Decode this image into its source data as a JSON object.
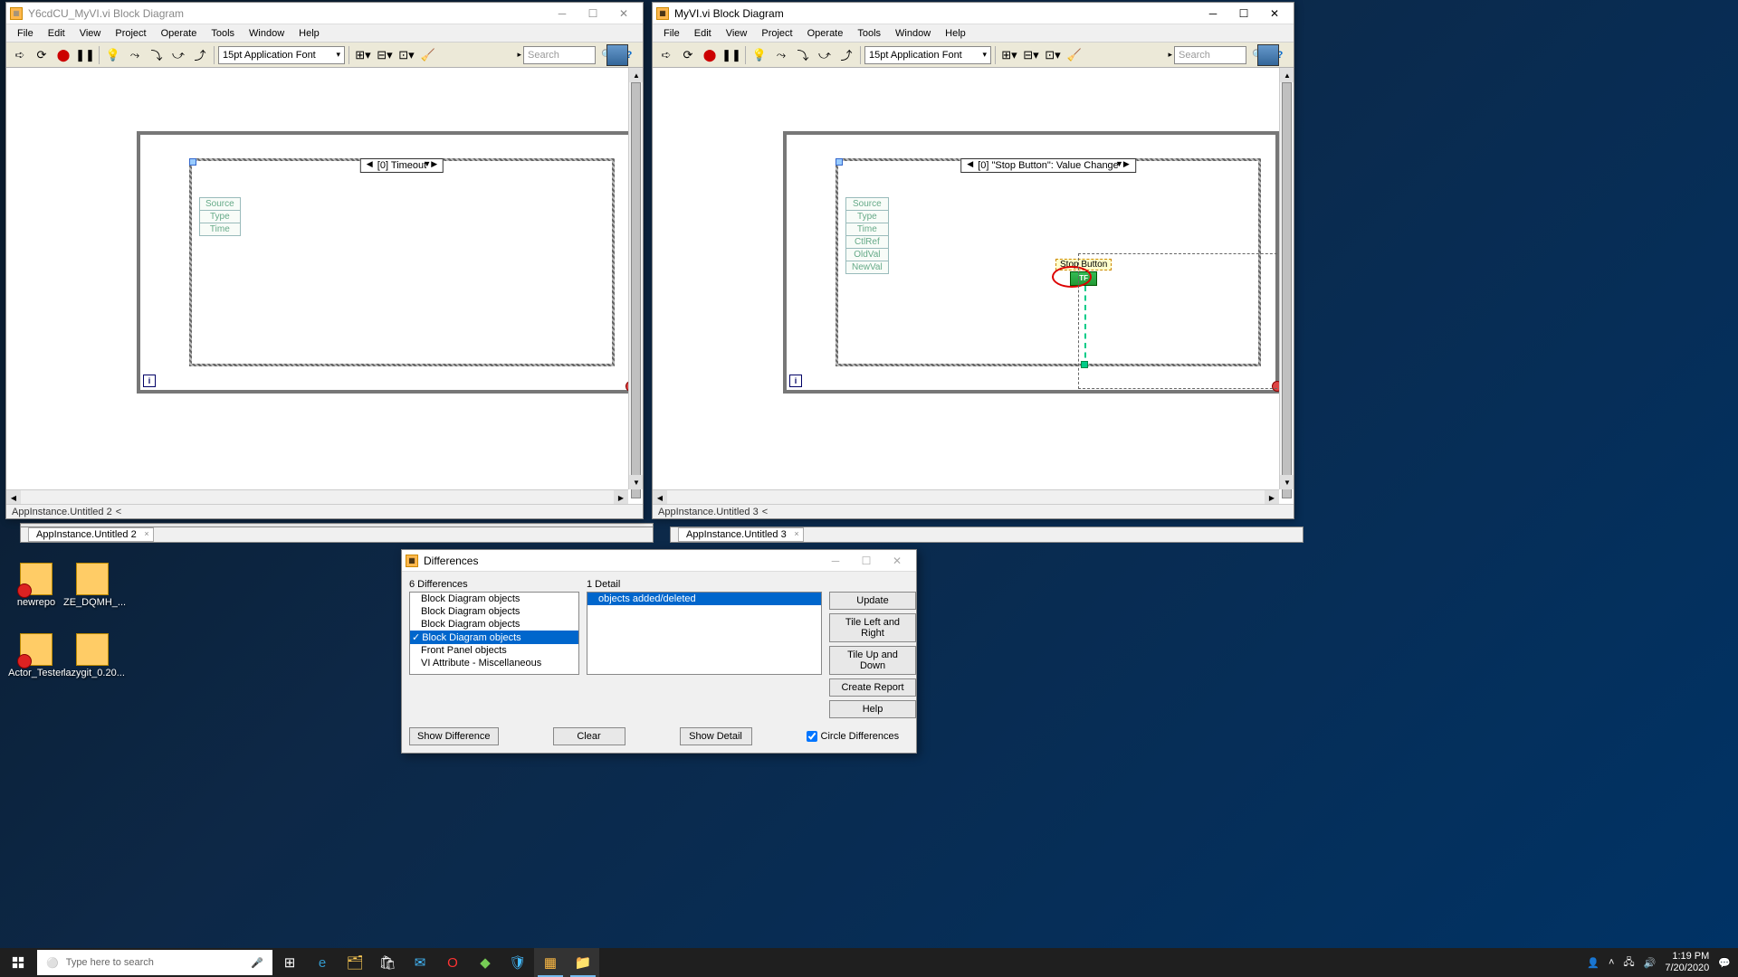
{
  "left_window": {
    "title": "Y6cdCU_MyVI.vi Block Diagram",
    "menus": [
      "File",
      "Edit",
      "View",
      "Project",
      "Operate",
      "Tools",
      "Window",
      "Help"
    ],
    "font_selector": "15pt Application Font",
    "search_placeholder": "Search",
    "event_case_label": "[0] Timeout",
    "event_fields": [
      "Source",
      "Type",
      "Time"
    ],
    "status_text": "AppInstance.Untitled  2",
    "tab_text": "AppInstance.Untitled  2"
  },
  "right_window": {
    "title": "MyVI.vi Block Diagram",
    "menus": [
      "File",
      "Edit",
      "View",
      "Project",
      "Operate",
      "Tools",
      "Window",
      "Help"
    ],
    "font_selector": "15pt Application Font",
    "search_placeholder": "Search",
    "event_case_label": "[0] \"Stop Button\": Value Change",
    "event_fields": [
      "Source",
      "Type",
      "Time",
      "CtlRef",
      "OldVal",
      "NewVal"
    ],
    "stop_button_label": "Stop Button",
    "status_text": "AppInstance.Untitled  3",
    "tab_text": "AppInstance.Untitled  3"
  },
  "hidden_bg": {
    "label_left": "File",
    "tab_left": "AppInstance.Untitled  2",
    "tab_right": "AppInstance.Untitled  3"
  },
  "differences": {
    "title": "Differences",
    "left_header": "6 Differences",
    "right_header": "1 Detail",
    "diff_list": [
      "Block Diagram objects",
      "Block Diagram objects",
      "Block Diagram objects",
      "Block Diagram objects",
      "Front Panel objects",
      "VI Attribute - Miscellaneous"
    ],
    "diff_list_selected_index": 3,
    "detail_list": [
      "objects added/deleted"
    ],
    "buttons": {
      "update": "Update",
      "tile_lr": "Tile Left and Right",
      "tile_ud": "Tile Up and Down",
      "report": "Create Report",
      "help": "Help",
      "show_diff": "Show Difference",
      "clear": "Clear",
      "show_detail": "Show Detail"
    },
    "circle_label": "Circle Differences",
    "circle_checked": true
  },
  "desktop": {
    "icons": [
      {
        "label": "newrepo"
      },
      {
        "label": "ZE_DQMH_..."
      },
      {
        "label": "Actor_Tester"
      },
      {
        "label": "lazygit_0.20..."
      }
    ],
    "edge_text": "edge"
  },
  "taskbar": {
    "search_placeholder": "Type here to search",
    "time": "1:19 PM",
    "date": "7/20/2020"
  }
}
